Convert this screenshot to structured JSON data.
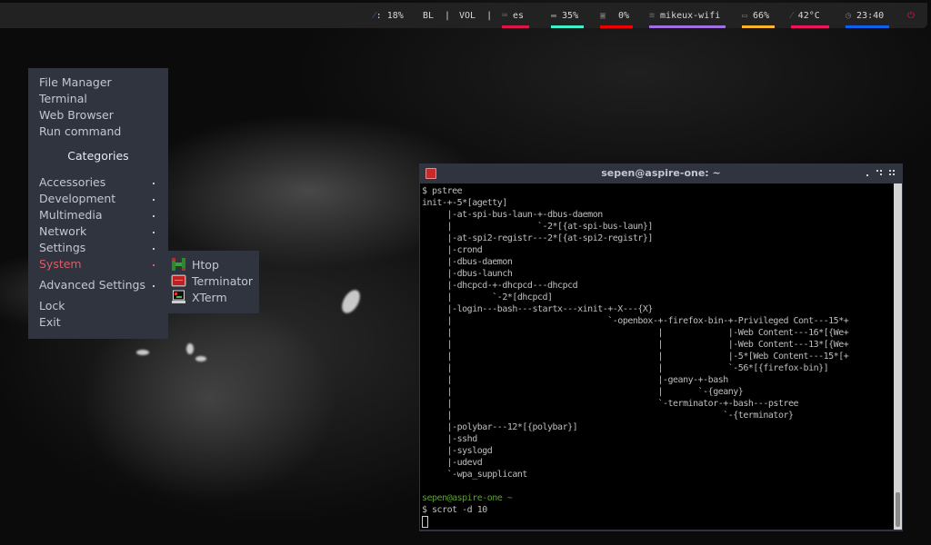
{
  "polybar": {
    "backlight": {
      "icon": "brightness-icon",
      "value": "18%",
      "label": "BL"
    },
    "volume": {
      "label": "VOL"
    },
    "keyboard": {
      "icon": "keyboard-icon",
      "value": "es",
      "color": "#e0144c"
    },
    "memory": {
      "icon": "memory-icon",
      "value": "35%",
      "color": "#3ff0cf"
    },
    "cpu": {
      "icon": "cpu-icon",
      "value": "0%",
      "color": "#f00000"
    },
    "wifi": {
      "icon": "wifi-icon",
      "value": "mikeux-wifi",
      "color": "#a070e0"
    },
    "battery": {
      "icon": "battery-icon",
      "value": "66%",
      "color": "#ffb52a"
    },
    "temperature": {
      "icon": "thermometer-icon",
      "value": "42°C",
      "color": "#f0145c"
    },
    "clock": {
      "icon": "clock-icon",
      "value": "23:40",
      "color": "#1060f0"
    },
    "power": {
      "icon": "power-icon",
      "color": "#e0144c"
    }
  },
  "menu": {
    "items": [
      {
        "label": "File Manager"
      },
      {
        "label": "Terminal"
      },
      {
        "label": "Web Browser"
      },
      {
        "label": "Run command"
      }
    ],
    "categories_header": "Categories",
    "categories": [
      {
        "label": "Accessories"
      },
      {
        "label": "Development"
      },
      {
        "label": "Multimedia"
      },
      {
        "label": "Network"
      },
      {
        "label": "Settings"
      },
      {
        "label": "System",
        "active": true
      }
    ],
    "advanced": {
      "label": "Advanced Settings"
    },
    "lock": {
      "label": "Lock"
    },
    "exit": {
      "label": "Exit"
    },
    "active_color": "#e05a66"
  },
  "submenu": {
    "items": [
      {
        "label": "Htop",
        "icon": "htop-icon"
      },
      {
        "label": "Terminator",
        "icon": "terminator-icon"
      },
      {
        "label": "XTerm",
        "icon": "xterm-icon"
      }
    ]
  },
  "terminal": {
    "title": "sepen@aspire-one: ~",
    "lines": [
      "$ pstree",
      "init-+-5*[agetty]",
      "     |-at-spi-bus-laun-+-dbus-daemon",
      "     |                 `-2*[{at-spi-bus-laun}]",
      "     |-at-spi2-registr---2*[{at-spi2-registr}]",
      "     |-crond",
      "     |-dbus-daemon",
      "     |-dbus-launch",
      "     |-dhcpcd-+-dhcpcd---dhcpcd",
      "     |        `-2*[dhcpcd]",
      "     |-login---bash---startx---xinit-+-X---{X}",
      "     |                               `-openbox-+-firefox-bin-+-Privileged Cont---15*+",
      "     |                                         |             |-Web Content---16*[{We+",
      "     |                                         |             |-Web Content---13*[{We+",
      "     |                                         |             |-5*[Web Content---15*[+",
      "     |                                         |             `-56*[{firefox-bin}]",
      "     |                                         |-geany-+-bash",
      "     |                                         |       `-{geany}",
      "     |                                         `-terminator-+-bash---pstree",
      "     |                                                      `-{terminator}",
      "     |-polybar---12*[{polybar}]",
      "     |-sshd",
      "     |-syslogd",
      "     |-udevd",
      "     `-wpa_supplicant",
      ""
    ],
    "prompt_user": "sepen@aspire-one ~",
    "command": "$ scrot -d 10"
  }
}
